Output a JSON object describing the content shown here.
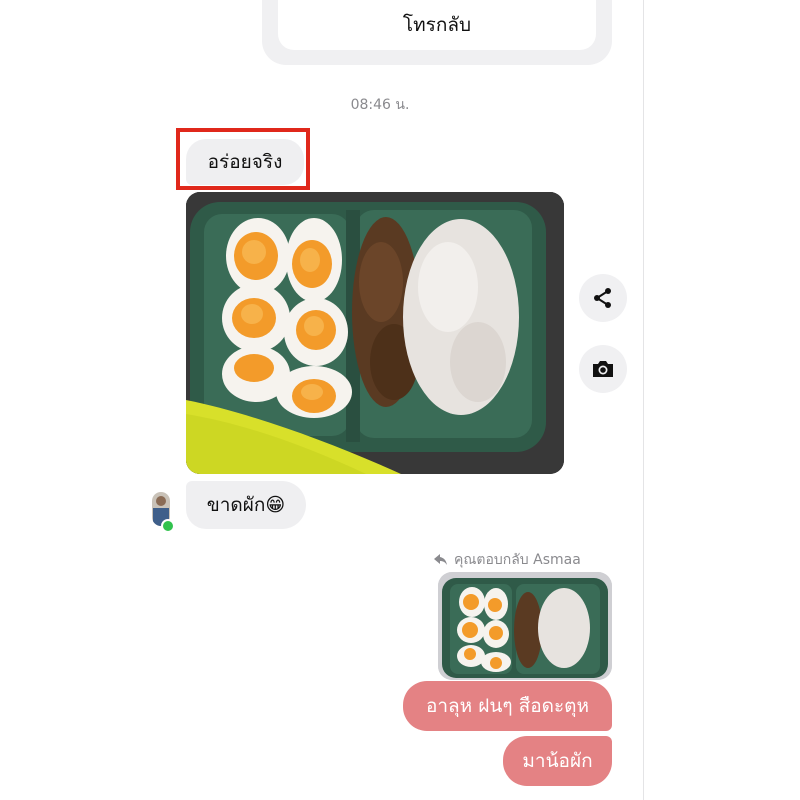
{
  "call_card": {
    "button_label": "โทรกลับ"
  },
  "timestamp": "08:46 น.",
  "messages": {
    "received_1": "อร่อยจริง",
    "received_2": "ขาดผัก😁",
    "reply_note": "คุณตอบกลับ Asmaa",
    "sent_1": "อาลุห ฝนๆ สือดะตุห",
    "sent_2": "มาน้อผัก"
  },
  "icons": {
    "share": "share-icon",
    "camera": "camera-icon",
    "reply": "reply-arrow-icon"
  },
  "colors": {
    "sent_bubble": "#e48284",
    "received_bubble": "#efeff1",
    "highlight_box": "#e0281b",
    "online": "#31c24d"
  }
}
